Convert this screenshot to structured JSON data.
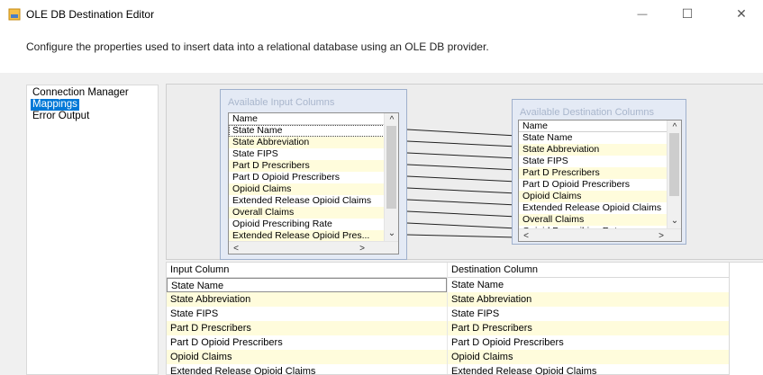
{
  "window": {
    "title": "OLE DB Destination Editor",
    "minimize_glyph": "—",
    "maximize_glyph": "☐",
    "close_glyph": "✕"
  },
  "description": "Configure the properties used to insert data into a relational database using an OLE DB provider.",
  "nav": {
    "items": [
      {
        "label": "Connection Manager",
        "selected": false
      },
      {
        "label": "Mappings",
        "selected": true
      },
      {
        "label": "Error Output",
        "selected": false
      }
    ]
  },
  "input_columns": {
    "title": "Available Input Columns",
    "header": "Name",
    "rows": [
      "State Name",
      "State Abbreviation",
      "State FIPS",
      "Part D Prescribers",
      "Part D Opioid Prescribers",
      "Opioid Claims",
      "Extended Release Opioid Claims",
      "Overall Claims",
      "Opioid Prescribing Rate",
      "Extended Release Opioid Pres..."
    ]
  },
  "destination_columns": {
    "title": "Available Destination Columns",
    "header": "Name",
    "rows": [
      "State Name",
      "State Abbreviation",
      "State FIPS",
      "Part D Prescribers",
      "Part D Opioid Prescribers",
      "Opioid Claims",
      "Extended Release Opioid Claims",
      "Overall Claims",
      "Opioid Prescribing Rate"
    ]
  },
  "mapping_table": {
    "headers": [
      "Input Column",
      "Destination Column"
    ],
    "rows": [
      [
        "State Name",
        "State Name"
      ],
      [
        "State Abbreviation",
        "State Abbreviation"
      ],
      [
        "State FIPS",
        "State FIPS"
      ],
      [
        "Part D Prescribers",
        "Part D Prescribers"
      ],
      [
        "Part D Opioid Prescribers",
        "Part D Opioid Prescribers"
      ],
      [
        "Opioid Claims",
        "Opioid Claims"
      ],
      [
        "Extended Release Opioid Claims",
        "Extended Release Opioid Claims"
      ]
    ]
  },
  "colors": {
    "selection": "#0078d7",
    "alt_row": "#fffcdc",
    "panel_box": "#e4eaf5"
  },
  "icons": {
    "app": "ole-db-destination-icon",
    "scroll_up": "▲",
    "scroll_down": "▼",
    "scroll_left": "<",
    "scroll_right": ">"
  }
}
